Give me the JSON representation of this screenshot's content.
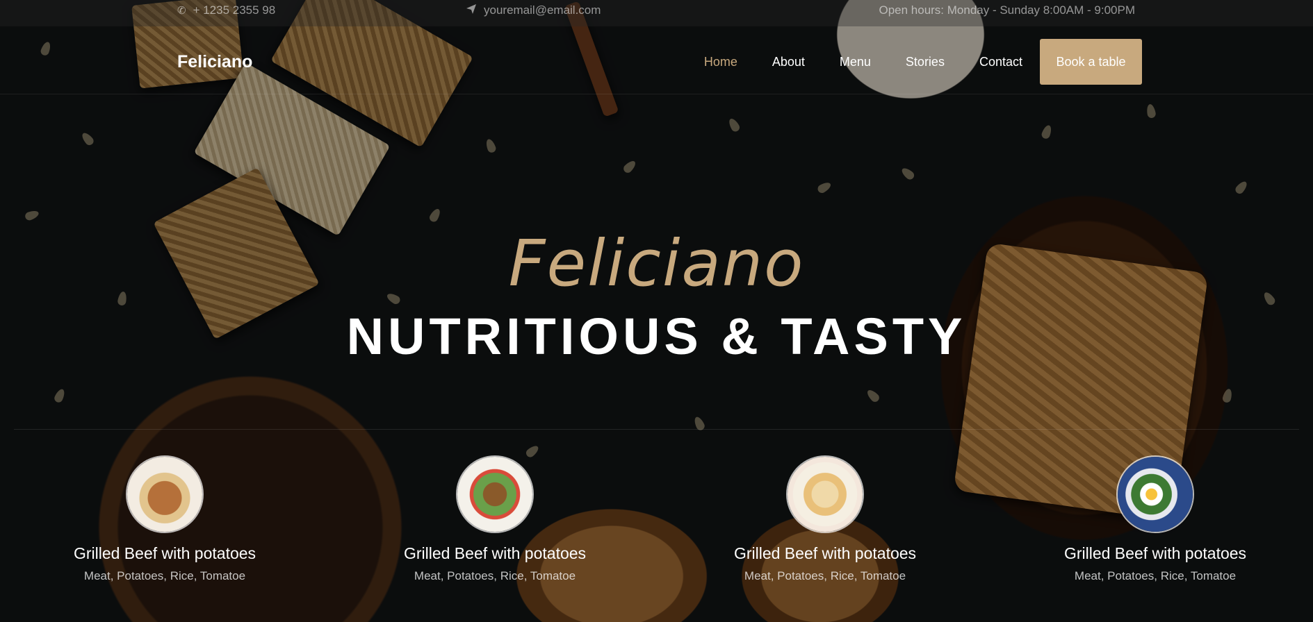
{
  "topbar": {
    "phone_icon": "phone-icon",
    "phone": "+ 1235 2355 98",
    "email_icon": "paper-plane-icon",
    "email": "youremail@email.com",
    "hours": "Open hours: Monday - Sunday 8:00AM - 9:00PM"
  },
  "nav": {
    "brand": "Feliciano",
    "items": [
      {
        "label": "Home",
        "active": true
      },
      {
        "label": "About"
      },
      {
        "label": "Menu"
      },
      {
        "label": "Stories"
      },
      {
        "label": "Contact"
      }
    ],
    "cta": "Book a table"
  },
  "hero": {
    "script": "Feliciano",
    "title": "NUTRITIOUS & TASTY"
  },
  "dishes": [
    {
      "name": "Grilled Beef with potatoes",
      "desc": "Meat, Potatoes, Rice, Tomatoe"
    },
    {
      "name": "Grilled Beef with potatoes",
      "desc": "Meat, Potatoes, Rice, Tomatoe"
    },
    {
      "name": "Grilled Beef with potatoes",
      "desc": "Meat, Potatoes, Rice, Tomatoe"
    },
    {
      "name": "Grilled Beef with potatoes",
      "desc": "Meat, Potatoes, Rice, Tomatoe"
    }
  ],
  "colors": {
    "accent": "#c8a97e",
    "background": "#121415"
  }
}
